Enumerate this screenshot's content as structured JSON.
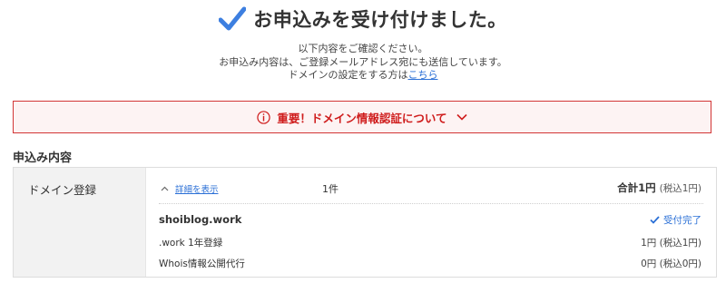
{
  "header": {
    "title": "お申込みを受け付けました。",
    "check_color": "#3d7fe0"
  },
  "intro": {
    "line1": "以下内容をご確認ください。",
    "line2": "お申込み内容は、ご登録メールアドレス宛にも送信しています。",
    "line3_prefix": "ドメインの設定をする方は",
    "line3_link": "こちら"
  },
  "alert": {
    "text": "重要！ドメイン情報認証について",
    "color": "#cf1c1c",
    "icon": "info-circle-icon"
  },
  "section": {
    "title": "申込み内容"
  },
  "order": {
    "row_label": "ドメイン登録",
    "detail_link": "詳細を表示",
    "count": "1件",
    "total_label": "合計1円",
    "total_tax": "(税込1円)",
    "domain": "shoiblog.work",
    "status": "受付完了",
    "items": [
      {
        "name": ".work 1年登録",
        "price": "1円 (税込1円)"
      },
      {
        "name": "Whois情報公開代行",
        "price": "0円 (税込0円)"
      }
    ]
  }
}
